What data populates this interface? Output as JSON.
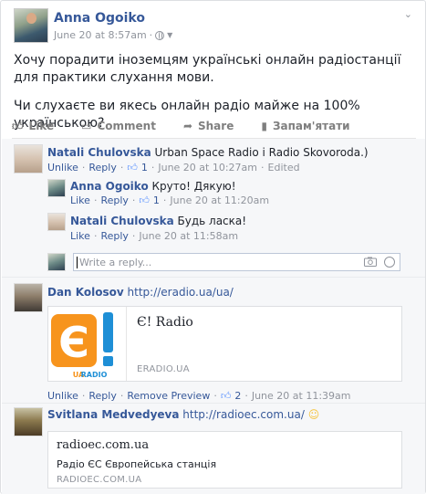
{
  "post": {
    "author": "Anna Ogoiko",
    "timestamp": "June 20 at 8:57am",
    "text": [
      "Хочу порадити іноземцям українські онлайн радіостанції для практики слухання мови.",
      "Чи слухаєте ви якесь онлайн радіо майже на 100% українською?"
    ],
    "actions": {
      "like": "Like",
      "comment": "Comment",
      "share": "Share",
      "save": "Запам'ятати"
    }
  },
  "comments": [
    {
      "author": "Natali Chulovska",
      "text": "Urban Space Radio і Radio Skovoroda.)",
      "meta": {
        "unlike": "Unlike",
        "reply": "Reply",
        "likes": "1",
        "time": "June 20 at 10:27am",
        "edited": "Edited"
      }
    },
    {
      "author": "Anna Ogoiko",
      "text": "Круто! Дякую!",
      "meta": {
        "like": "Like",
        "reply": "Reply",
        "likes": "1",
        "time": "June 20 at 11:20am"
      }
    },
    {
      "author": "Natali Chulovska",
      "text": "Будь ласка!",
      "meta": {
        "like": "Like",
        "reply": "Reply",
        "time": "June 20 at 11:58am"
      }
    },
    {
      "author": "Dan Kolosov",
      "link": "http://eradio.ua/ua/",
      "card": {
        "title": "Є! Radio",
        "domain": "ERADIO.UA",
        "logo_sub": "UARADIO"
      },
      "meta": {
        "unlike": "Unlike",
        "reply": "Reply",
        "remove_preview": "Remove Preview",
        "likes": "2",
        "time": "June 20 at 11:39am"
      }
    },
    {
      "author": "Svitlana Medvedyeva",
      "link": "http://radioec.com.ua/",
      "card": {
        "title": "radioec.com.ua",
        "desc": "Радіо ЄС Європейська станція",
        "domain": "RADIOEC.COM.UA"
      }
    }
  ],
  "reply_box": {
    "placeholder": "Write a reply..."
  },
  "colors": {
    "link": "#365899",
    "meta": "#90949c",
    "comments_bg": "#f6f7f9",
    "logo_orange": "#f7941d",
    "logo_blue": "#1e8fd6"
  }
}
